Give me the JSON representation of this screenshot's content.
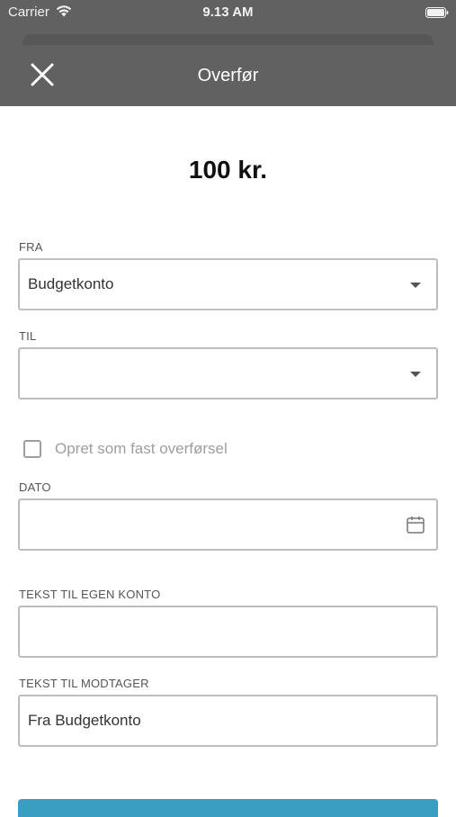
{
  "status_bar": {
    "carrier": "Carrier",
    "time": "9.13 AM"
  },
  "nav": {
    "title": "Overfør",
    "close_icon": "close-icon"
  },
  "amount": "100 kr.",
  "form": {
    "from": {
      "label": "FRA",
      "value": "Budgetkonto"
    },
    "to": {
      "label": "TIL",
      "value": ""
    },
    "recurring": {
      "label": "Opret som fast overførsel",
      "checked": false
    },
    "date": {
      "label": "DATO",
      "value": ""
    },
    "own_text": {
      "label": "TEKST TIL EGEN KONTO",
      "value": ""
    },
    "recipient_text": {
      "label": "TEKST TIL MODTAGER",
      "value": "Fra Budgetkonto"
    }
  },
  "colors": {
    "header_bg": "#616161",
    "accent": "#3a9ec3",
    "border": "#bdbdbd"
  }
}
